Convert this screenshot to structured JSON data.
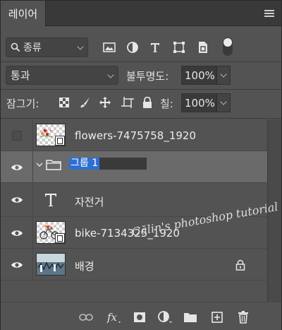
{
  "panel": {
    "tab_label": "레이어"
  },
  "filter": {
    "kind_label": "종류"
  },
  "blend": {
    "mode_label": "통과",
    "opacity_label": "불투명도:",
    "opacity_value": "100%"
  },
  "lock": {
    "label": "잠그기:",
    "fill_label": "칠:",
    "fill_value": "100%"
  },
  "layers": [
    {
      "name": "flowers-7475758_1920",
      "visible": false,
      "type": "smart-object"
    },
    {
      "name": "그룹 1",
      "visible": true,
      "type": "group",
      "selected": true,
      "editing": true
    },
    {
      "name": "자전거",
      "visible": true,
      "type": "text"
    },
    {
      "name": "bike-7134325_1920",
      "visible": true,
      "type": "smart-object"
    },
    {
      "name": "배경",
      "visible": true,
      "type": "background",
      "locked": true
    }
  ],
  "watermark": "Călin's photoshop tutorial",
  "colors": {
    "panel_bg": "#535353",
    "selected_row": "#6a6a6a",
    "selection_highlight": "#2d6fd3"
  }
}
